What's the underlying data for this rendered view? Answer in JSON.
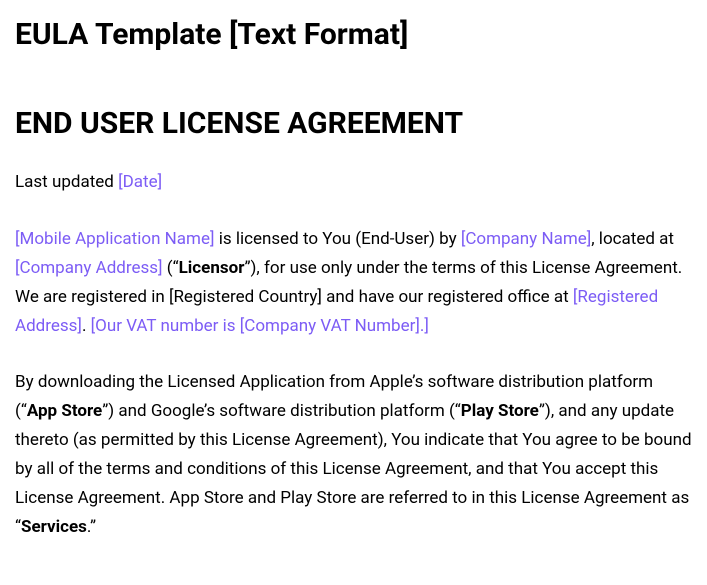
{
  "title": "EULA Template [Text Format]",
  "heading": "END USER LICENSE AGREEMENT",
  "lastUpdated": {
    "prefix": "Last updated ",
    "date": "[Date]"
  },
  "para1": {
    "mobileAppName": "[Mobile Application Name]",
    "t1": " is licensed to You (End-User) by ",
    "companyName": "[Company Name]",
    "t2": ", located at ",
    "companyAddress": "[Company Address]",
    "t3": " (“",
    "licensor": "Licensor",
    "t4": "”), for use only under the terms of this License Agreement. We are registered in [Registered Country] and have our registered office at ",
    "registeredAddress": "[Registered Address]",
    "t5": ". ",
    "vatNumber": "[Our VAT number is [Company VAT Number].]"
  },
  "para2": {
    "t1": "By downloading the Licensed Application from Apple’s software distribution platform (“",
    "appStore": "App Store",
    "t2": "”) and Google’s software distribution platform (“",
    "playStore": "Play Store",
    "t3": "”), and any update thereto (as permitted by this License Agreement), You indicate that You agree to be bound by all of the terms and conditions of this License Agreement, and that You accept this License Agreement. App Store and Play Store are referred to in this License Agreement as “",
    "services": "Services",
    "t4": ".”"
  }
}
